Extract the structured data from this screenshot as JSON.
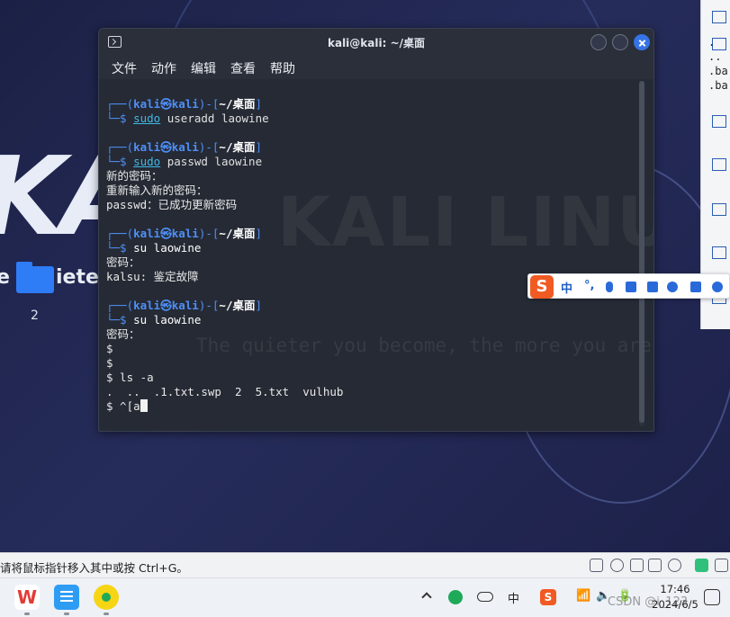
{
  "desktop": {
    "logo_text": "KAL",
    "folder_label_left": "e",
    "folder_label_right": "iete",
    "folder_number": "2"
  },
  "side_panel": {
    "lines": [
      ".",
      "..",
      ".ba",
      ".ba"
    ]
  },
  "terminal": {
    "title": "kali@kali: ~/桌面",
    "menu": [
      "文件",
      "动作",
      "编辑",
      "查看",
      "帮助"
    ],
    "watermark_big": "KALI LINUX",
    "watermark_small": "The quieter you become, the more you are able to hear",
    "prompt": {
      "open": "┌──(",
      "user": "kali",
      "at": "㉿",
      "host": "kali",
      "mid": ")-[",
      "path": "~/桌面",
      "close": "]",
      "second": "└─$ "
    },
    "blocks": [
      {
        "cmd_sudo": "sudo",
        "cmd_rest": " useradd laowine"
      },
      {
        "cmd_sudo": "sudo",
        "cmd_rest": " passwd laowine"
      }
    ],
    "output": {
      "new_pw": "新的密码：",
      "retype_pw": "重新输入新的密码：",
      "passwd_ok": "passwd：已成功更新密码",
      "su_cmd": "su laowine",
      "pw_prompt": "密码：",
      "su_fail": "kalsu: 鉴定故障",
      "su_cmd2": "su laowine",
      "pw_prompt2": "密码：",
      "dollar1": "$",
      "dollar2": "$",
      "ls_cmd": "$ ls -a",
      "ls_out": ".  ..  .1.txt.swp  2  5.txt  vulhub",
      "last_line": "$ ^[a"
    }
  },
  "ime": {
    "logo": "S",
    "lang": "中",
    "punct": "°,"
  },
  "statusbar": {
    "hint": "请将鼠标指针移入其中或按 Ctrl+G。"
  },
  "taskbar": {
    "wps_label": "W",
    "tray_lang": "中",
    "tray_sogou": "S",
    "time": "17:46",
    "date": "2024/6/5",
    "csdn": "CSDN @i_123"
  }
}
